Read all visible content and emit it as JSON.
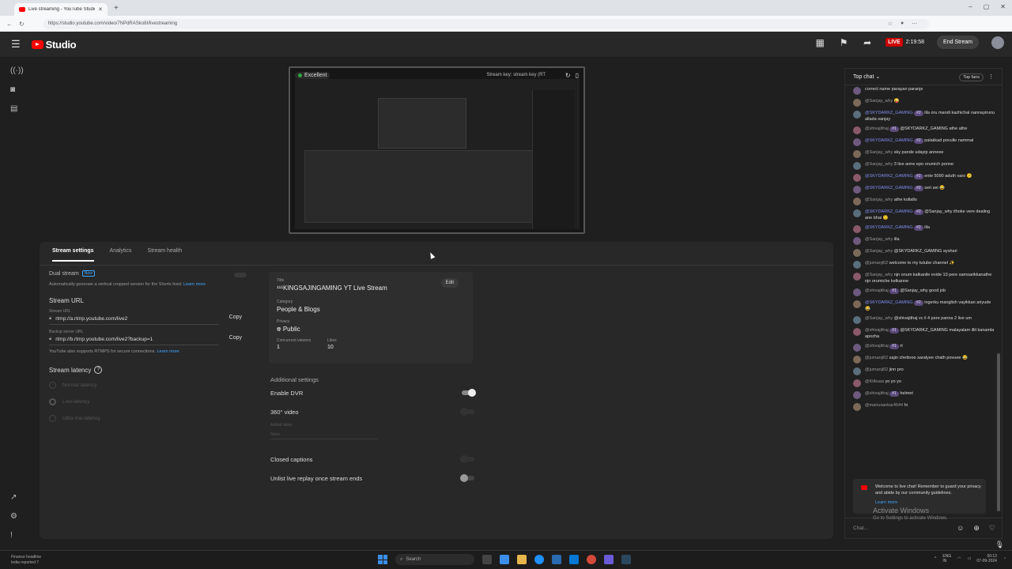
{
  "browser": {
    "tab_title": "Live streaming - YouTube Studio",
    "url": "https://studio.youtube.com/video/7NPdRASko8I/livestreaming"
  },
  "header": {
    "logo_text": "Studio",
    "live_label": "LIVE",
    "live_time": "2:19:58",
    "end_stream": "End Stream"
  },
  "preview": {
    "quality": "Excellent",
    "stream_key_label": "Stream key:  stream key (RT"
  },
  "tabs": [
    "Stream settings",
    "Analytics",
    "Stream health"
  ],
  "settings": {
    "dual_stream": "Dual stream",
    "new_tag": "New",
    "dual_help": "Automatically generate a vertical cropped version for the Shorts feed.",
    "learn_more": "Learn more",
    "stream_url_title": "Stream URL",
    "stream_url_label": "Stream URL",
    "stream_url": "rtmp://a.rtmp.youtube.com/live2",
    "backup_label": "Backup server URL",
    "backup_url": "rtmp://b.rtmp.youtube.com/live2?backup=1",
    "copy": "Copy",
    "rtmps_help": "YouTube also supports RTMPS for secure connections.",
    "latency_title": "Stream latency",
    "latency_options": [
      "Normal latency",
      "Low-latency",
      "Ultra low-latency"
    ]
  },
  "info": {
    "title_label": "Title",
    "title": "¹¹¹KINGSAJINGAMING YT Live Stream",
    "category_label": "Category",
    "category": "People & Blogs",
    "privacy_label": "Privacy",
    "privacy": "Public",
    "viewers_label": "Concurrent viewers",
    "viewers": "1",
    "likes_label": "Likes",
    "likes": "10",
    "edit": "Edit"
  },
  "additional": {
    "title": "Additional settings",
    "enable_dvr": "Enable DVR",
    "video_360": "360° video",
    "added_delay": "Added delay",
    "added_delay_value": "None",
    "closed_captions": "Closed captions",
    "unlist_replay": "Unlist live replay once stream ends"
  },
  "chat": {
    "header": "Top chat",
    "top_fans": "Top fans",
    "placeholder": "Chat...",
    "messages": [
      {
        "author": "",
        "text": "correct name parayan paranje",
        "badge": ""
      },
      {
        "author": "@Sanjay_why",
        "text": "😜",
        "badge": ""
      },
      {
        "author": "@SKYDARKZ_GAMING",
        "text": "illa oru mandi kazhichal nannayirunu allada sanjay",
        "badge": "#2",
        "mod": true
      },
      {
        "author": "@shivajithaj",
        "text": "@SKYDARKZ_GAMING athe athe",
        "badge": "#1"
      },
      {
        "author": "@SKYDARKZ_GAMING",
        "text": "palakkad povulle nammal",
        "badge": "#2",
        "mod": true
      },
      {
        "author": "@Sanjay_why",
        "text": "sky pande udayip anneee",
        "badge": ""
      },
      {
        "author": "@Sanjay_why",
        "text": "3 live anne epo orumich ponne",
        "badge": ""
      },
      {
        "author": "@SKYDARKZ_GAMING",
        "text": "ente 5090 aduth varo 😕",
        "badge": "#2",
        "mod": true
      },
      {
        "author": "@SKYDARKZ_GAMING",
        "text": "seri sei 😂",
        "badge": "#2",
        "mod": true
      },
      {
        "author": "@Sanjay_why",
        "text": "athe kollallo",
        "badge": ""
      },
      {
        "author": "@SKYDARKZ_GAMING",
        "text": "@Sanjay_why ithoke vere dealing ane bhai 😌",
        "badge": "#2",
        "mod": true
      },
      {
        "author": "@SKYDARKZ_GAMING",
        "text": "illa",
        "badge": "#2",
        "mod": true
      },
      {
        "author": "@Sanjay_why",
        "text": "illa",
        "badge": ""
      },
      {
        "author": "@Sanjay_why",
        "text": "@SKYDARKZ_GAMING ayshari",
        "badge": ""
      },
      {
        "author": "@jumanji02",
        "text": "welcome to my tutube channel ✨",
        "badge": ""
      },
      {
        "author": "@Sanjay_why",
        "text": "njn onum kalkanile evide 10 pere samsarikkanathe njn orumiche kelkanne",
        "badge": ""
      },
      {
        "author": "@shivajithaj",
        "text": "@Sanjay_why good job",
        "badge": "#1"
      },
      {
        "author": "@SKYDARKZ_GAMING",
        "text": "ingerku manglish vayikkan ariyude 😂",
        "badge": "#2",
        "mod": true
      },
      {
        "author": "@Sanjay_why",
        "text": "@shivajithaj vc il 4 pere panna 2 live um",
        "badge": ""
      },
      {
        "author": "@shivajithaj",
        "text": "@SKYDARKZ_GAMING malayalam illit kanamla apozha",
        "badge": "#1"
      },
      {
        "author": "@shivajithaj",
        "text": "rt",
        "badge": "#1"
      },
      {
        "author": "@jumanji02",
        "text": "sajin chettooo saralyee chath povuee 😂",
        "badge": ""
      },
      {
        "author": "@jumanji02",
        "text": "jinn pro",
        "badge": ""
      },
      {
        "author": "@Kilbuaa",
        "text": "yo yo yo",
        "badge": ""
      },
      {
        "author": "@shivajithaj",
        "text": "helmet",
        "badge": "#1"
      },
      {
        "author": "@manusankar4544",
        "text": "hi",
        "badge": ""
      }
    ],
    "welcome": "Welcome to live chat! Remember to guard your privacy and abide by our community guidelines.",
    "welcome_link": "Learn more"
  },
  "overlay": {
    "activate": "Activate Windows",
    "activate_sub": "Go to Settings to activate Windows."
  },
  "taskbar": {
    "news_title": "Finance headline",
    "news_sub": "India reported 7",
    "search": "Search",
    "lang": "ENG",
    "lang2": "IN",
    "time": "00:13",
    "date": "07-09-2024"
  },
  "colors": {
    "accent_live": "#cc0000",
    "link": "#3ea6ff",
    "moderator": "#7f8cf0"
  }
}
